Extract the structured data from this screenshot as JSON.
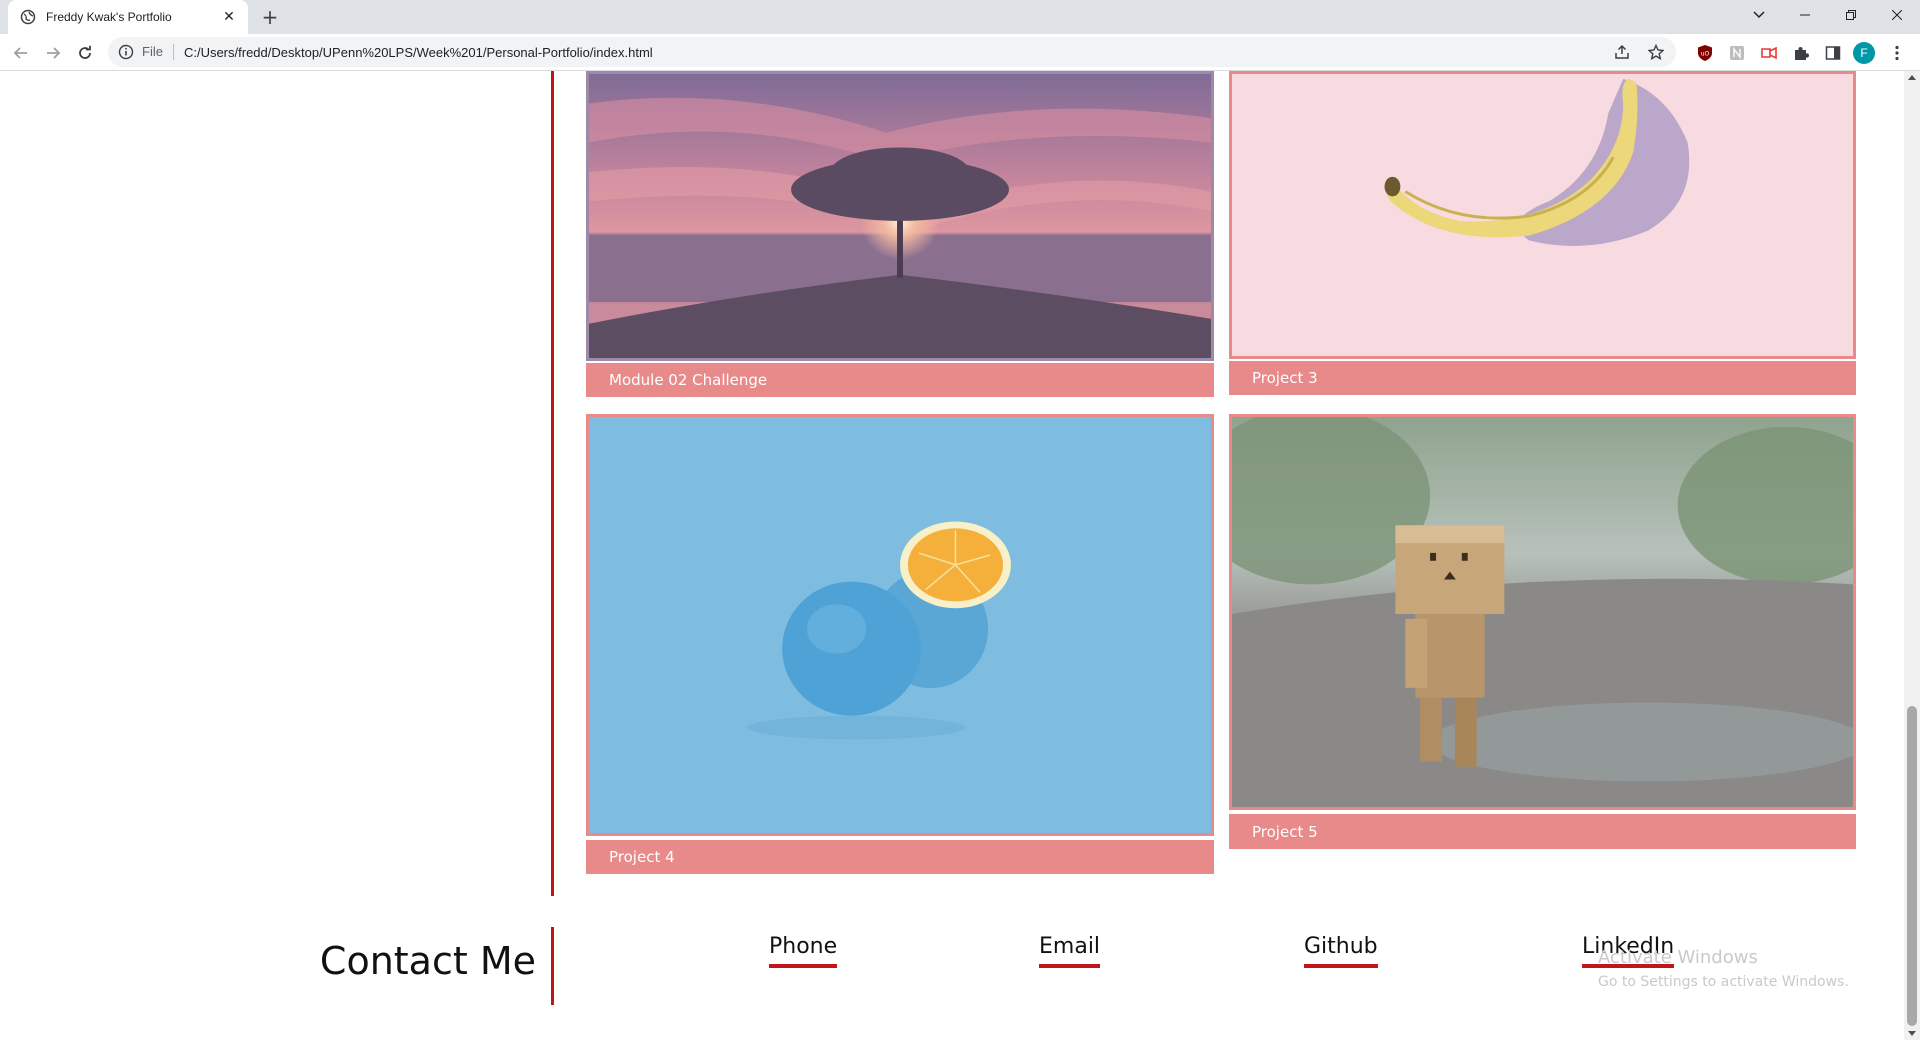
{
  "browser": {
    "tab_title": "Freddy Kwak's Portfolio",
    "url_scheme": "File",
    "url": "C:/Users/fredd/Desktop/UPenn%20LPS/Week%201/Personal-Portfolio/index.html",
    "profile_initial": "F",
    "accent_color": "#0097a7"
  },
  "work": {
    "cards": [
      {
        "caption": "Module 02 Challenge",
        "image": "sunset-tree-photo"
      },
      {
        "caption": "Project 3",
        "image": "banana-photo"
      },
      {
        "caption": "Project 4",
        "image": "orange-photo"
      },
      {
        "caption": "Project 5",
        "image": "cardboard-robot-photo"
      }
    ],
    "caption_color": "#e88a8a",
    "accent_line_color": "#c2151b"
  },
  "contact": {
    "title": "Contact Me",
    "links": [
      "Phone",
      "Email",
      "Github",
      "LinkedIn"
    ]
  },
  "watermark": {
    "title": "Activate Windows",
    "subtitle": "Go to Settings to activate Windows."
  }
}
